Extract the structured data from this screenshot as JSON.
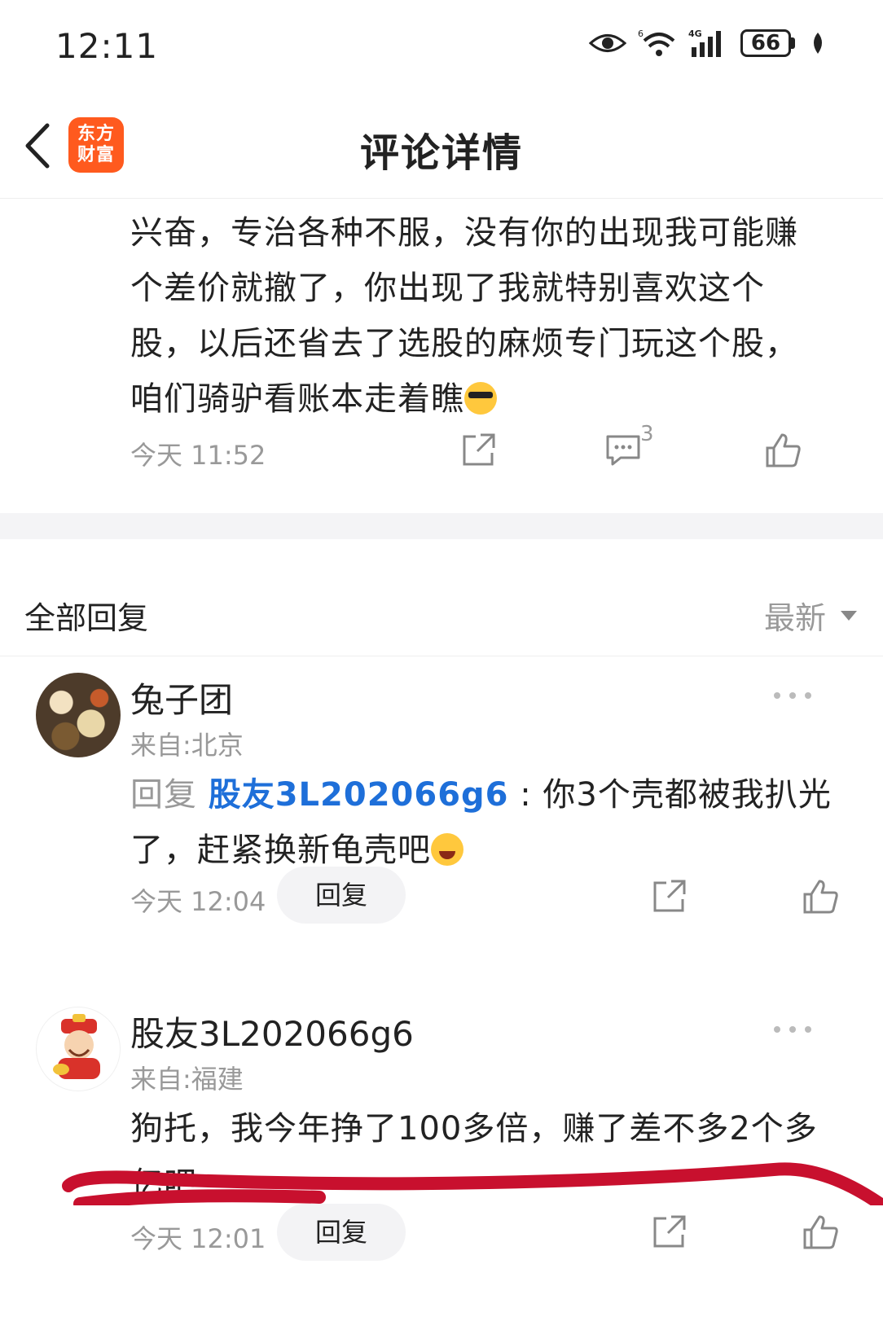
{
  "status_bar": {
    "time": "12:11",
    "battery": "66"
  },
  "header": {
    "title": "评论详情",
    "app_logo_line1": "东方",
    "app_logo_line2": "财富"
  },
  "main_comment": {
    "text": "兴奋，专治各种不服，没有你的出现我可能赚个差价就撤了，你出现了我就特别喜欢这个股，以后还省去了选股的麻烦专门玩这个股，咱们骑驴看账本走着瞧",
    "time": "今天 11:52",
    "comment_count": "3"
  },
  "replies_section": {
    "title": "全部回复",
    "sort_label": "最新"
  },
  "replies": [
    {
      "username": "兔子团",
      "location": "来自:北京",
      "prefix": "回复 ",
      "target": "股友3L202066g6",
      "text": " : 你3个壳都被我扒光了，赶紧换新龟壳吧",
      "time": "今天 12:04",
      "reply_label": "回复"
    },
    {
      "username": "股友3L202066g6",
      "location": "来自:福建",
      "text": "狗托，我今年挣了100多倍，赚了差不多2个多亿吧",
      "time": "今天 12:01",
      "reply_label": "回复"
    }
  ],
  "colors": {
    "brand": "#ff5a1e",
    "link": "#1e6fd9",
    "muted": "#999999",
    "annotation": "#c8102e"
  },
  "icons": [
    "back-arrow-icon",
    "eye-icon",
    "wifi-icon",
    "signal-icon",
    "battery-icon",
    "share-icon",
    "comment-icon",
    "like-icon",
    "more-icon",
    "sort-caret-icon"
  ]
}
